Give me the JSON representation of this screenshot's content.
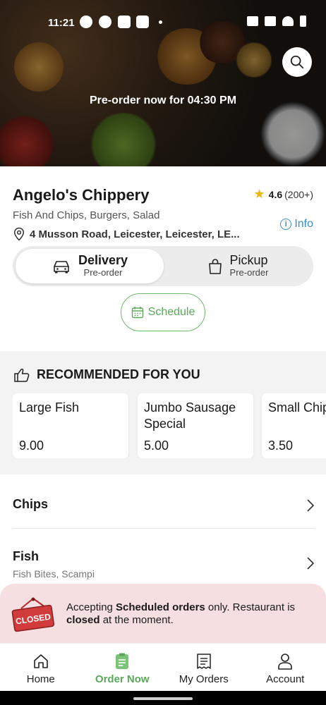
{
  "status_bar": {
    "time": "11:21"
  },
  "hero": {
    "preorder_text": "Pre-order now for 04:30 PM"
  },
  "restaurant": {
    "name": "Angelo's Chippery",
    "rating": "4.6",
    "rating_count": "(200+)",
    "cuisine": "Fish And Chips, Burgers, Salad",
    "address": "4 Musson Road, Leicester, Leicester, LE...",
    "info_label": "Info"
  },
  "order_mode": {
    "delivery": {
      "label": "Delivery",
      "sub": "Pre-order"
    },
    "pickup": {
      "label": "Pickup",
      "sub": "Pre-order"
    },
    "schedule_label": "Schedule"
  },
  "recommended": {
    "heading": "RECOMMENDED FOR YOU",
    "items": [
      {
        "name": "Large Fish",
        "price": "9.00"
      },
      {
        "name": "Jumbo Sausage Special",
        "name_line1": "Jumbo Sausage",
        "name_line2": "Special",
        "price": "5.00"
      },
      {
        "name": "Small Chips",
        "price": "3.50"
      }
    ]
  },
  "categories": [
    {
      "label": "Chips",
      "sub": ""
    },
    {
      "label": "Fish",
      "sub": "Fish Bites, Scampi"
    }
  ],
  "closed_banner": {
    "sign_text": "CLOSED",
    "part1": "Accepting ",
    "bold1": "Scheduled orders",
    "part2": " only. Restaurant is ",
    "bold2": "closed",
    "part3": " at the moment."
  },
  "nav": [
    {
      "label": "Home",
      "icon": "home-icon"
    },
    {
      "label": "Order Now",
      "icon": "order-icon"
    },
    {
      "label": "My Orders",
      "icon": "receipt-icon"
    },
    {
      "label": "Account",
      "icon": "person-icon"
    }
  ],
  "colors": {
    "accent": "#5aa858",
    "info": "#3b8fc4",
    "star": "#f1b60a",
    "banner": "#f6dfe1"
  }
}
